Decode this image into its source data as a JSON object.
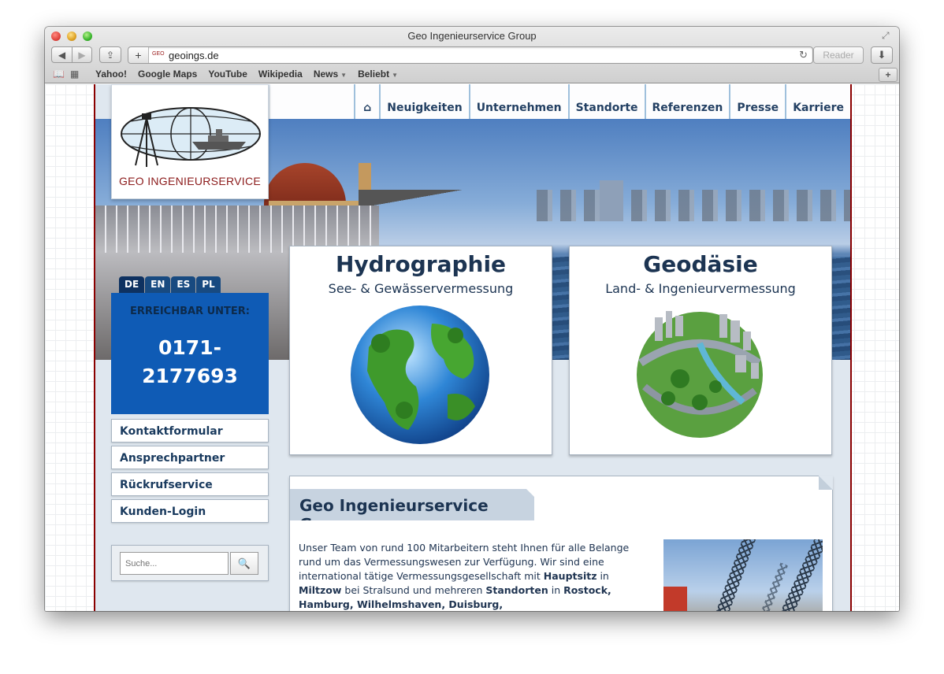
{
  "window": {
    "title": "Geo Ingenieurservice Group"
  },
  "toolbar": {
    "back_glyph": "◀",
    "forward_glyph": "▶",
    "share_glyph": "⇪",
    "addr_plus": "+",
    "favicon_text": "GEO",
    "url": "geoings.de",
    "reload_glyph": "↻",
    "reader_label": "Reader",
    "download_glyph": "⬇"
  },
  "bookmarks": {
    "items": [
      {
        "label": "Yahoo!"
      },
      {
        "label": "Google Maps"
      },
      {
        "label": "YouTube"
      },
      {
        "label": "Wikipedia"
      },
      {
        "label": "News",
        "caret": "▼"
      },
      {
        "label": "Beliebt",
        "caret": "▼"
      }
    ],
    "add_glyph": "+"
  },
  "site": {
    "logo_text": "GEO INGENIEURSERVICE",
    "nav": [
      {
        "label": "Neuigkeiten"
      },
      {
        "label": "Unternehmen"
      },
      {
        "label": "Standorte"
      },
      {
        "label": "Referenzen"
      },
      {
        "label": "Presse"
      },
      {
        "label": "Karriere"
      }
    ],
    "home_glyph": "⌂",
    "languages": [
      "DE",
      "EN",
      "ES",
      "PL"
    ],
    "reach": {
      "label": "ERREICHBAR UNTER:",
      "phone_line1": "0171-",
      "phone_line2": "2177693"
    },
    "side_links": [
      "Kontaktformular",
      "Ansprechpartner",
      "Rückrufservice",
      "Kunden-Login"
    ],
    "search": {
      "placeholder": "Suche...",
      "button_glyph": "🔍"
    },
    "cards": [
      {
        "title": "Hydrographie",
        "subtitle": "See- & Gewässervermessung"
      },
      {
        "title": "Geodäsie",
        "subtitle": "Land- & Ingenieurvermessung"
      }
    ],
    "content": {
      "heading": "Geo Ingenieurservice Group",
      "p_1": "Unser Team von rund 100 Mitarbeitern steht Ihnen für alle Belange rund um das Vermessungswesen zur Verfügung. Wir sind eine international tätige Vermessungsgesellschaft mit ",
      "b_1": "Hauptsitz",
      "p_2": " in ",
      "b_2": "Miltzow",
      "p_3": " bei Stralsund und mehreren ",
      "b_3": "Standorten",
      "p_4": " in ",
      "b_4": "Rostock, Hamburg, Wilhelmshaven, Duisburg,"
    }
  },
  "colors": {
    "brand_blue": "#0f5bb5",
    "navy": "#1c3452",
    "logo_red": "#8b1a1a",
    "edge_red": "#8b0000"
  }
}
